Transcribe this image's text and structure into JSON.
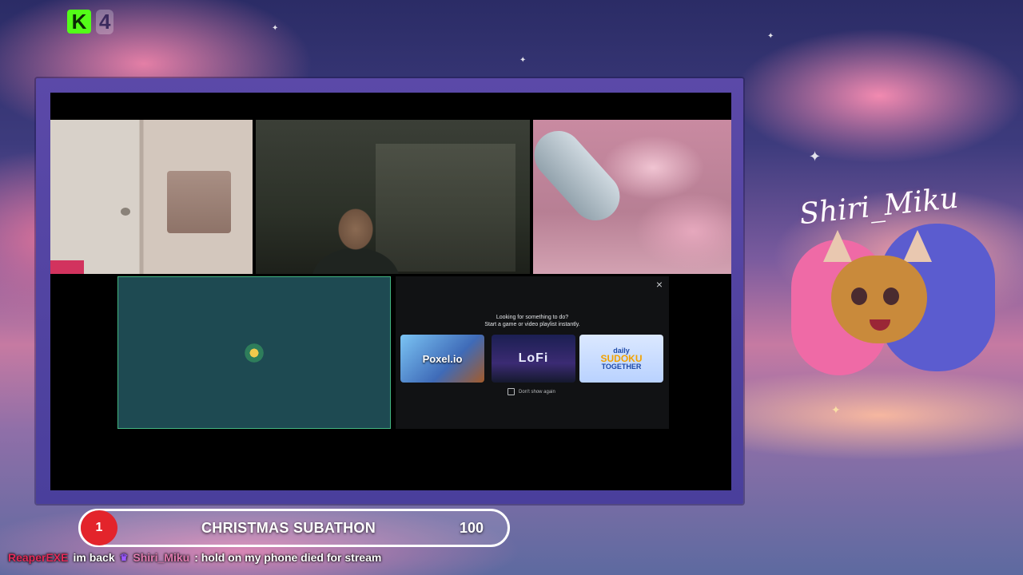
{
  "kick_badge": {
    "logo_letter": "K",
    "number": "4"
  },
  "video_call": {
    "launcher": {
      "headline": "Looking for something to do?",
      "subheadline": "Start a game or video playlist instantly.",
      "close_glyph": "×",
      "tiles": [
        {
          "label": "Poxel.io",
          "name": "poxel-io"
        },
        {
          "label": "LoFi",
          "name": "lofi"
        },
        {
          "label_top": "daily",
          "label_main": "SUDOKU",
          "label_bottom": "TOGETHER",
          "name": "sudoku-together"
        }
      ],
      "dont_show_again": "Don't show again"
    }
  },
  "streamer_overlay": {
    "name": "Shiri_Miku"
  },
  "subathon_goal": {
    "current": "1",
    "title": "CHRISTMAS SUBATHON",
    "target": "100",
    "accent_color": "#e3242b"
  },
  "chat_line": {
    "user1": "ReaperEXE",
    "message1": "im back",
    "badge_icon": "♛",
    "user2": "Shiri_Miku",
    "message2": ": hold on my phone died for stream"
  }
}
